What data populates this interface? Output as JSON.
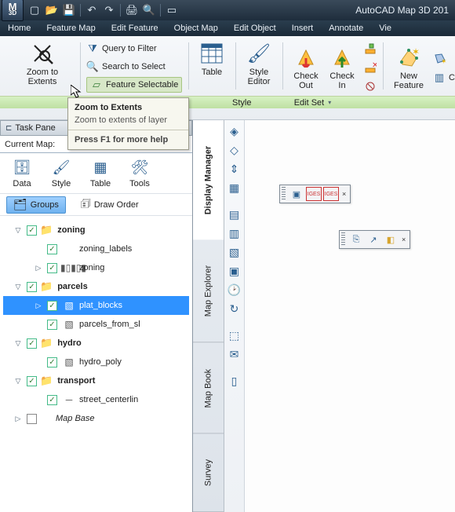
{
  "app": {
    "title": "AutoCAD Map 3D 201",
    "iconTop": "M",
    "iconSub": "3D"
  },
  "qat": {
    "items": [
      "new-file",
      "open",
      "save",
      "sep",
      "undo",
      "redo",
      "sep",
      "print",
      "search",
      "sep",
      "select"
    ]
  },
  "menu": {
    "items": [
      "Home",
      "Feature Map",
      "Edit Feature",
      "Object Map",
      "Edit Object",
      "Insert",
      "Annotate",
      "Vie"
    ]
  },
  "ribbon": {
    "zoomBtn": "Zoom to Extents",
    "queries": {
      "filter": "Query to Filter",
      "select": "Search to Select",
      "selectable": "Feature Selectable"
    },
    "table": "Table",
    "styleEditor": "Style Editor",
    "checkOut": "Check Out",
    "checkIn": "Check In",
    "newFeature": "New Feature",
    "cogo": "COGO",
    "groups": {
      "style": "Style",
      "editSet": "Edit Set"
    }
  },
  "tooltip": {
    "title": "Zoom to Extents",
    "desc": "Zoom to extents of layer",
    "help": "Press F1 for more help"
  },
  "taskpane": {
    "header": "Task Pane",
    "currentMapLabel": "Current Map:",
    "tools": {
      "data": "Data",
      "style": "Style",
      "table": "Table",
      "toolsLbl": "Tools"
    },
    "tabs": {
      "groups": "Groups",
      "drawOrder": "Draw Order"
    },
    "tree": {
      "zoning": {
        "name": "zoning",
        "labels": "zoning_labels",
        "layer": "zoning"
      },
      "parcels": {
        "name": "parcels",
        "plat": "plat_blocks",
        "pfs": "parcels_from_sl"
      },
      "hydro": {
        "name": "hydro",
        "poly": "hydro_poly"
      },
      "transport": {
        "name": "transport",
        "street": "street_centerlin"
      },
      "base": "Map Base"
    }
  },
  "sidetabs": {
    "display": "Display Manager",
    "explorer": "Map Explorer",
    "book": "Map Book",
    "survey": "Survey"
  },
  "floatbars": {
    "a": [
      "cam",
      "ig1",
      "ig2"
    ],
    "b": [
      "l1",
      "l2",
      "l3"
    ]
  }
}
